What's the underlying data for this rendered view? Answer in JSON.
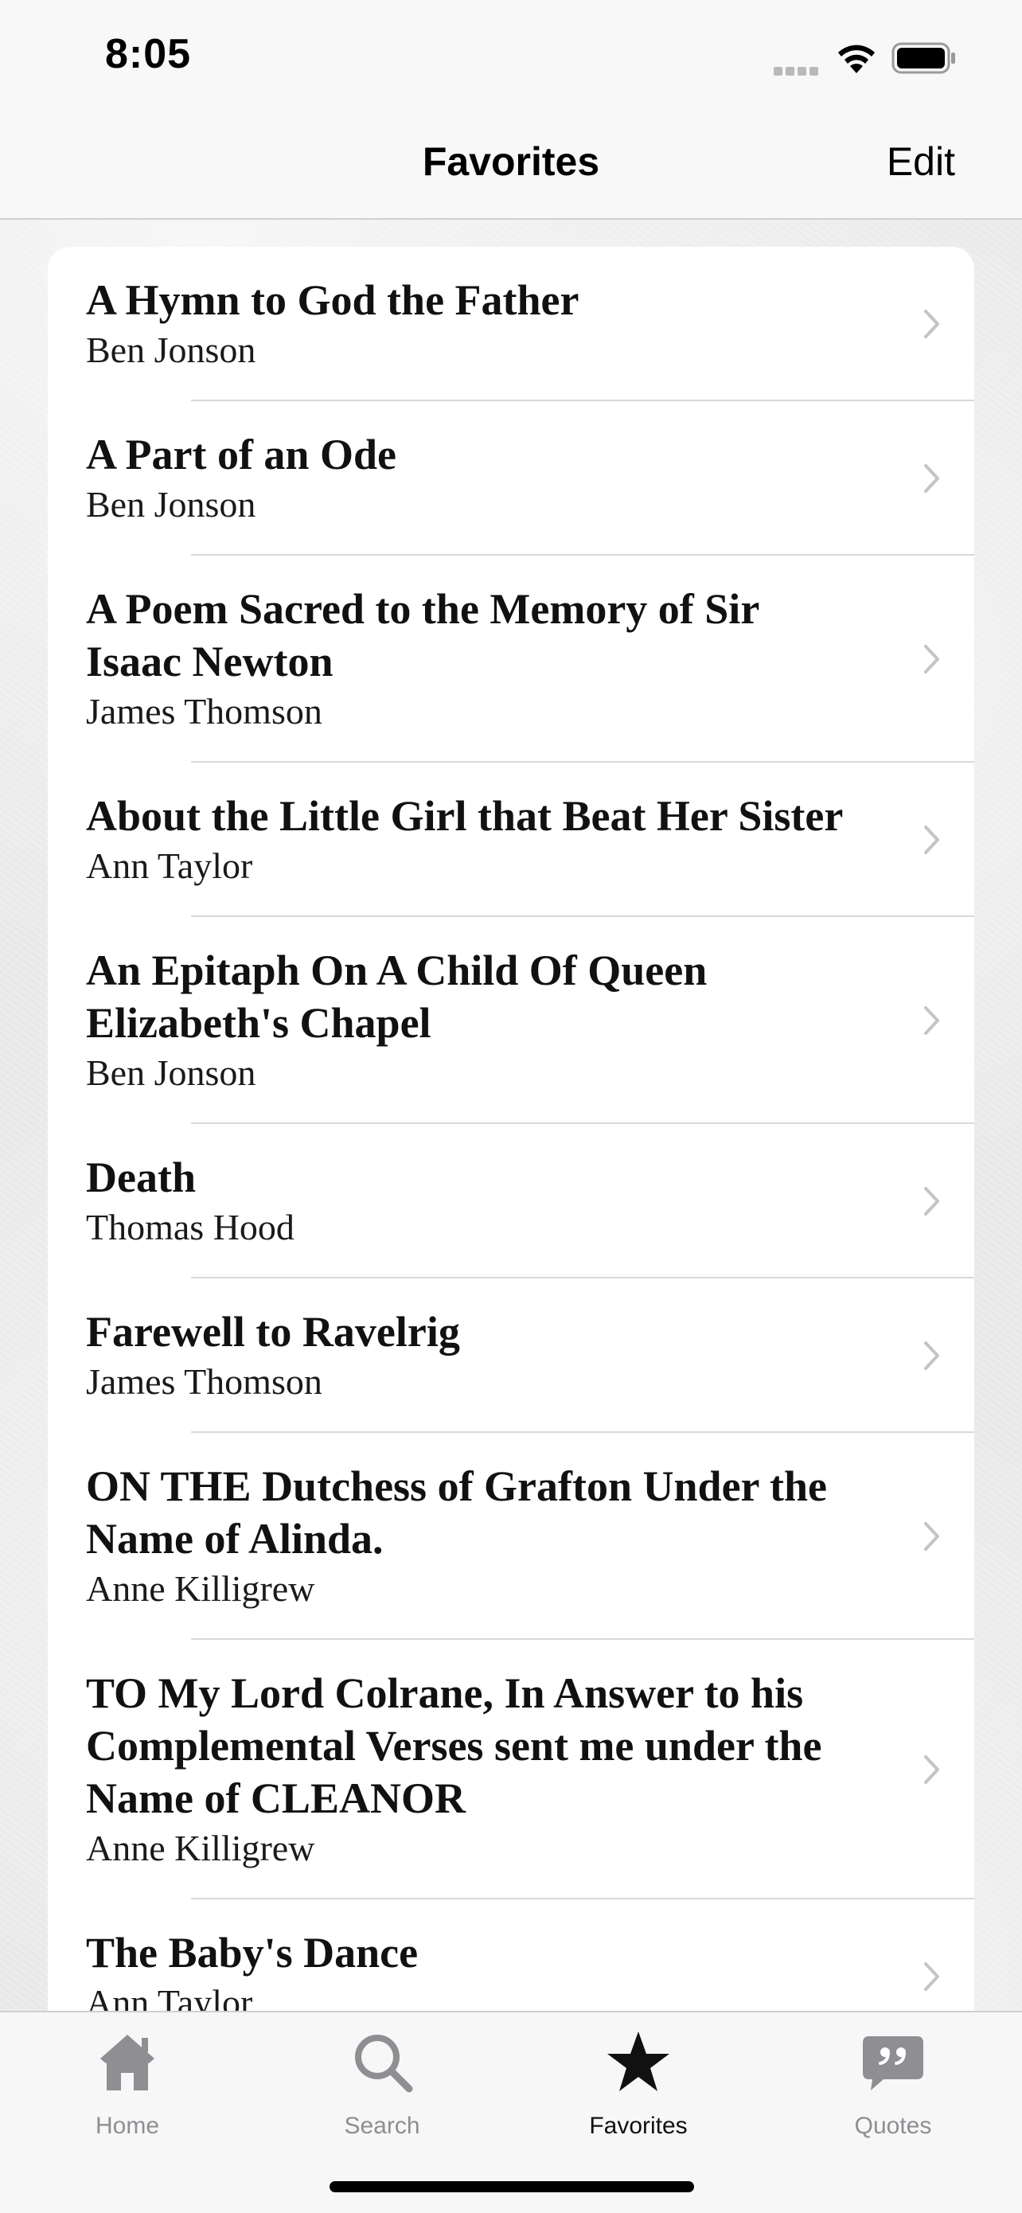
{
  "status_bar": {
    "time": "8:05",
    "icons": [
      "signal-dots-icon",
      "wifi-icon",
      "battery-icon"
    ]
  },
  "nav": {
    "title": "Favorites",
    "edit_label": "Edit"
  },
  "items": [
    {
      "title_lines": [
        "A Hymn to God the Father"
      ],
      "author": "Ben Jonson"
    },
    {
      "title_lines": [
        "A Part of an Ode"
      ],
      "author": "Ben Jonson"
    },
    {
      "title_lines": [
        "A Poem Sacred to the Memory of Sir",
        "Isaac Newton"
      ],
      "author": "James Thomson"
    },
    {
      "title_lines": [
        "About the Little Girl that Beat Her Sister"
      ],
      "author": "Ann Taylor"
    },
    {
      "title_lines": [
        "An Epitaph On A Child Of Queen",
        "Elizabeth's Chapel"
      ],
      "author": "Ben Jonson"
    },
    {
      "title_lines": [
        "Death"
      ],
      "author": "Thomas Hood"
    },
    {
      "title_lines": [
        "Farewell to Ravelrig"
      ],
      "author": "James Thomson"
    },
    {
      "title_lines": [
        "ON THE Dutchess of Grafton Under the",
        "Name of Alinda."
      ],
      "author": "Anne Killigrew"
    },
    {
      "title_lines": [
        "TO My Lord Colrane, In Answer to his",
        "Complemental Verses sent me under the",
        "Name of CLEANOR"
      ],
      "author": "Anne Killigrew"
    },
    {
      "title_lines": [
        "The Baby's Dance"
      ],
      "author": "Ann Taylor"
    }
  ],
  "tabs": [
    {
      "label": "Home",
      "icon": "house-icon",
      "active": false
    },
    {
      "label": "Search",
      "icon": "magnifier-icon",
      "active": false
    },
    {
      "label": "Favorites",
      "icon": "star-icon",
      "active": true
    },
    {
      "label": "Quotes",
      "icon": "quote-bubble-icon",
      "active": false
    }
  ],
  "colors": {
    "tab_inactive": "#8e8e93",
    "tab_active": "#111111",
    "chevron": "#c4c4c6",
    "separator": "#d9d9d9"
  }
}
